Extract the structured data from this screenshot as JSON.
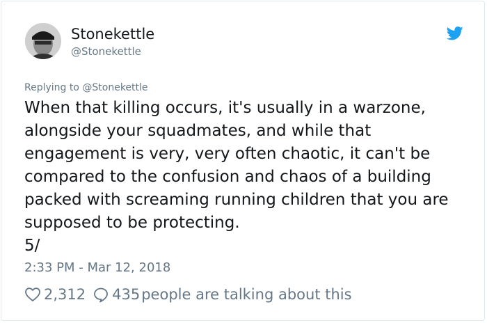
{
  "tweet": {
    "author_name": "Stonekettle",
    "author_handle": "@Stonekettle",
    "replying_prefix": "Replying to ",
    "replying_handle": "@Stonekettle",
    "text": "When that killing occurs, it's usually in a warzone,\nalongside your squadmates, and while that\nengagement is very, very often chaotic, it can't be\ncompared to the confusion and chaos of a building\npacked with screaming running children that you are\nsupposed to be protecting.\n5/",
    "timestamp": "2:33 PM - Mar 12, 2018",
    "like_count": "2,312",
    "talk_count": "435",
    "talk_label": "people are talking about this"
  },
  "icons": {
    "brand": "twitter-bird-icon",
    "like": "heart-icon",
    "reply": "speech-bubble-icon"
  },
  "colors": {
    "brand_blue": "#1da1f2",
    "text": "#14171a",
    "muted": "#657786",
    "border": "#e1e8ed"
  }
}
